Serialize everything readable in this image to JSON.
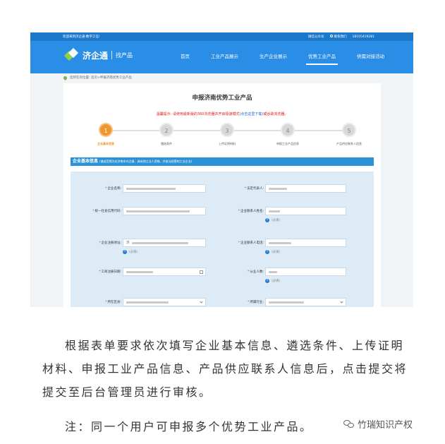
{
  "topbar": {
    "welcome": "欢迎来到济企通·数字工信!",
    "wechat": "微信公众号",
    "contact": "联系我们",
    "phone": "18105419281"
  },
  "header": {
    "logo_name": "济企通",
    "logo_sub": "找产品",
    "nav": [
      "首页",
      "工业产品展示",
      "生产企业展示",
      "优势工业产品",
      "供需对接活动"
    ],
    "active_nav": "优势工业产品"
  },
  "breadcrumb": "您所在的位置: 首页>申报济南优势工业产品",
  "page_title": "申报济南优势工业产品",
  "tip": {
    "prefix": "温馨提示: 请使用最新版的360浏览器并开启极速模式",
    "link": "(点击这里下载)",
    "suffix": "或谷歌浏览器。"
  },
  "steps": [
    {
      "num": "1",
      "label": "企业基本信息"
    },
    {
      "num": "2",
      "label": "遴选条件"
    },
    {
      "num": "3",
      "label": "上传证明材料"
    },
    {
      "num": "4",
      "label": "申报工业产品信息"
    },
    {
      "num": "5",
      "label": "产品供应联系人信息"
    }
  ],
  "active_step": 1,
  "section": {
    "title": "企业基本信息",
    "note": "(遴选范围为在济南市内注册、具有独立法人资格、并依法经营的工业企业)"
  },
  "form": {
    "company_name_label": "企业名称:",
    "legal_rep_label": "法定代表人:",
    "credit_code_label": "统一社会信用代码:",
    "contact_name_label": "企业联系人姓名:",
    "address_label": "企业注册地址:",
    "address_value": "济",
    "contact_phone_label": "企业联系人电话:",
    "reg_date_label": "工商注册日期:",
    "employees_label": "从业人数:",
    "district_label": "所在区县:",
    "industry_label": "所属行业:",
    "required_hint": "(必填)"
  },
  "paragraph1": "根据表单要求依次填写企业基本信息、遴选条件、上传证明材料、申报工业产品信息、产品供应联系人信息后，点击提交将提交至后台管理员进行审核。",
  "paragraph2": "注：同一个用户可申报多个优势工业产品。",
  "watermark": "竹瑞知识产权"
}
